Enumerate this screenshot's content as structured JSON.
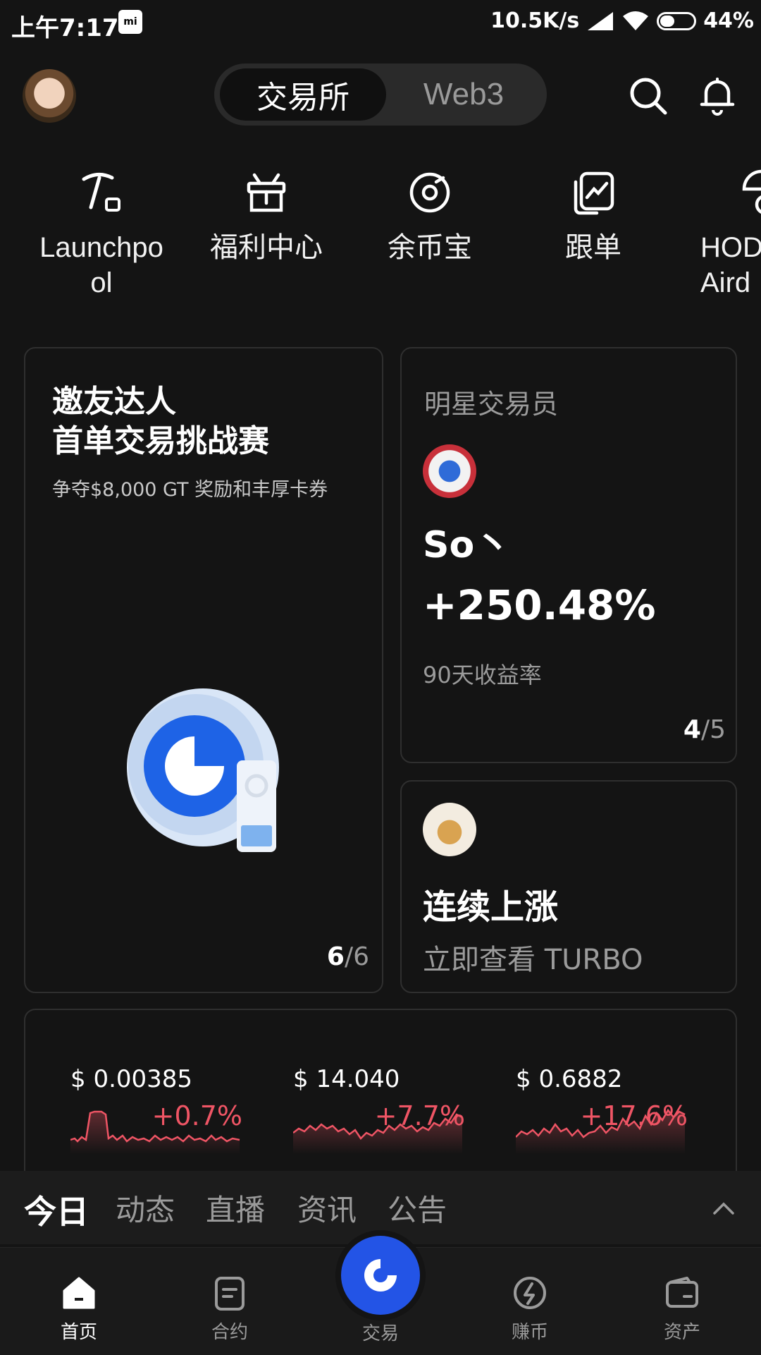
{
  "status": {
    "time": "上午7:17",
    "speed": "10.5K/s",
    "battery": "44%",
    "battery_level": 0.44
  },
  "header": {
    "tabs": {
      "exchange": "交易所",
      "web3": "Web3"
    }
  },
  "quick_actions": [
    {
      "label": "Launchpo\nol",
      "icon": "pickaxe-icon"
    },
    {
      "label": "福利中心",
      "icon": "gift-icon"
    },
    {
      "label": "余币宝",
      "icon": "coin-icon"
    },
    {
      "label": "跟单",
      "icon": "copy-trade-icon"
    },
    {
      "label": "HOD\nAird",
      "icon": "airdrop-icon"
    }
  ],
  "cards": {
    "promo": {
      "title": "邀友达人\n首单交易挑战赛",
      "subtitle": "争夺$8,000 GT 奖励和丰厚卡券",
      "pager_current": "6",
      "pager_total": "/6"
    },
    "star_trader": {
      "label": "明星交易员",
      "name": "So丶",
      "roi": "+250.48%",
      "roi_label": "90天收益率",
      "pager_current": "4",
      "pager_total": "/5"
    },
    "rising": {
      "title": "连续上涨",
      "subtitle": "立即查看 TURBO"
    }
  },
  "tickers": [
    {
      "price": "$ 0.00385",
      "change": "+0.7%"
    },
    {
      "price": "$ 14.040",
      "change": "+7.7%"
    },
    {
      "price": "$ 0.6882",
      "change": "+17.6%"
    }
  ],
  "feed_tabs": [
    "今日",
    "动态",
    "直播",
    "资讯",
    "公告"
  ],
  "nav": {
    "home": "首页",
    "futures": "合约",
    "trade": "交易",
    "earn": "赚币",
    "assets": "资产"
  }
}
